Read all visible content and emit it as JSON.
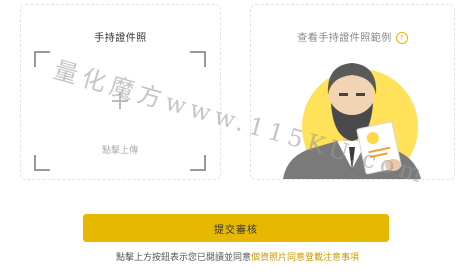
{
  "left_card": {
    "title": "手持證件照",
    "upload_label": "點擊上傳"
  },
  "right_card": {
    "title": "查看手持證件照範例",
    "help_icon": "?"
  },
  "submit": {
    "label": "提交審核"
  },
  "note": {
    "text": "點擊上方按鈕表示您已閱讀並同意",
    "link": "個資照片同意登載注意事項"
  },
  "watermark": {
    "text": "量化魔方www.115KU.com"
  },
  "colors": {
    "accent": "#e6b800",
    "link": "#c99a00"
  }
}
